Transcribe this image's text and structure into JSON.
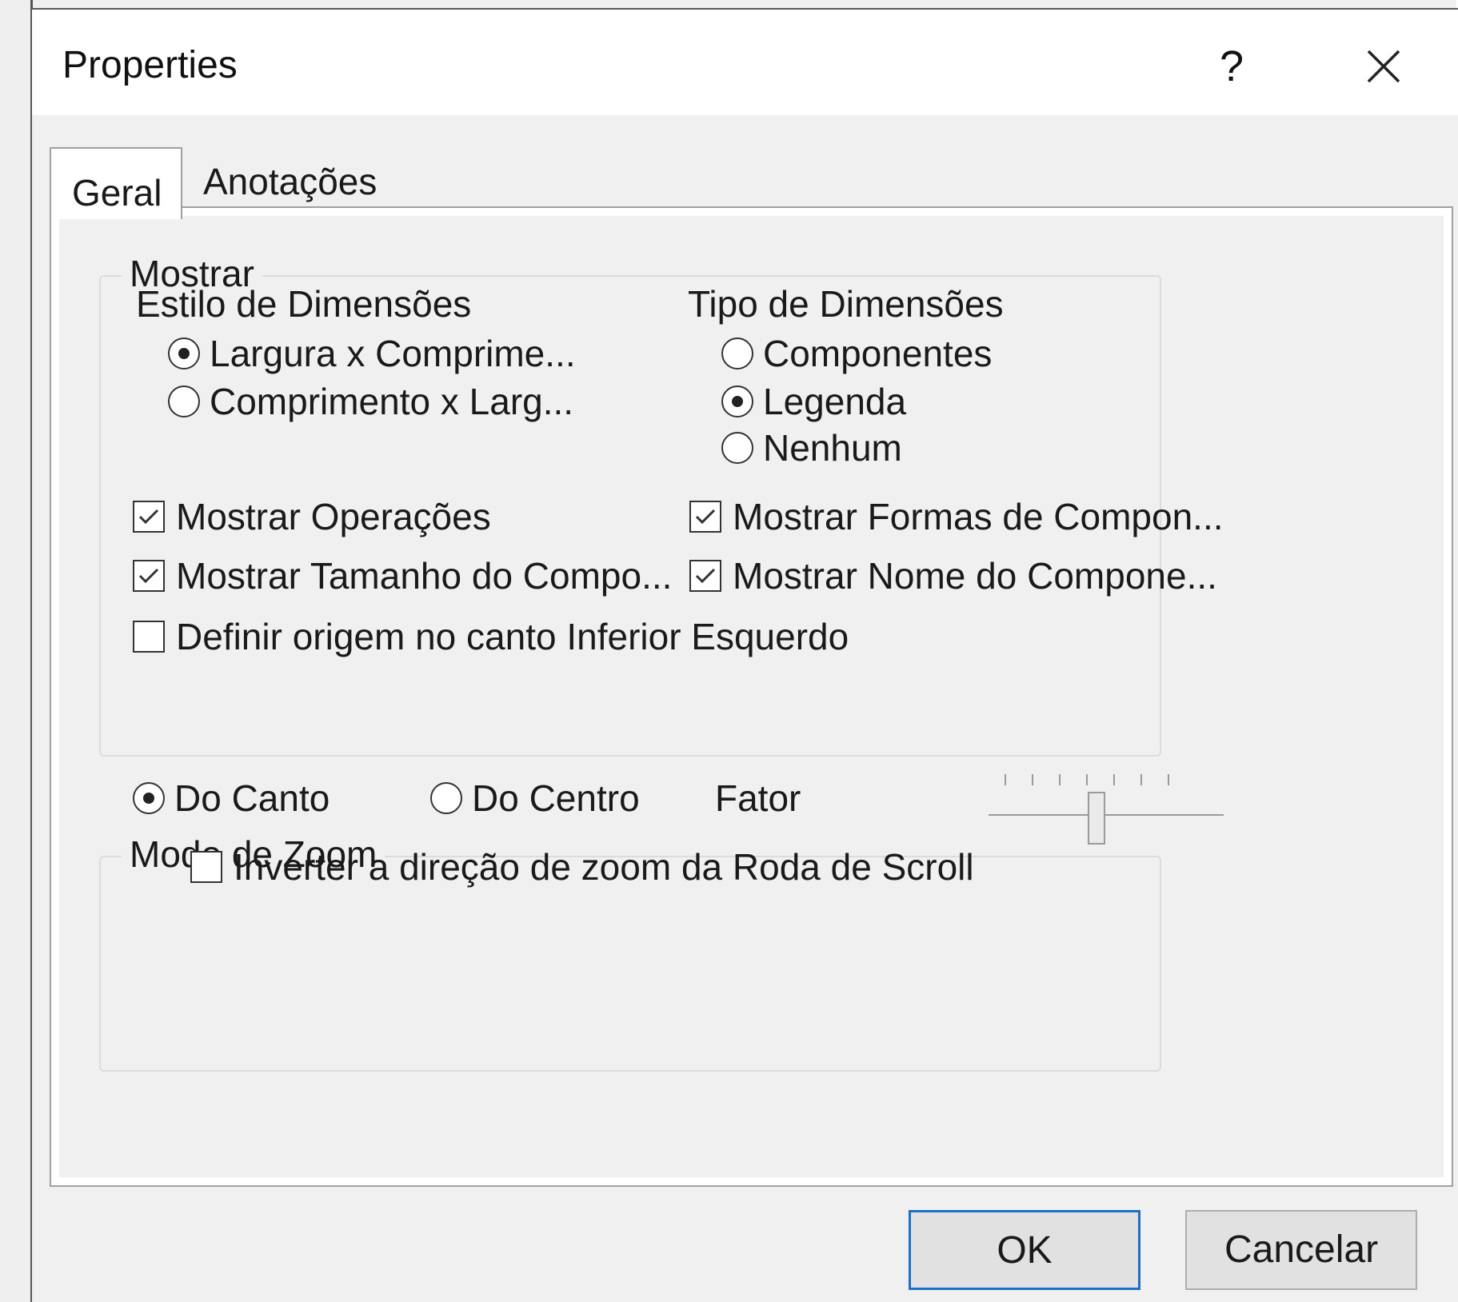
{
  "dialog": {
    "title": "Properties",
    "help_label": "?",
    "icons": {
      "close": "close-icon",
      "help": "help-icon"
    }
  },
  "tabs": [
    {
      "label": "Geral",
      "active": true
    },
    {
      "label": "Anotações",
      "active": false
    }
  ],
  "mostrar": {
    "title": "Mostrar",
    "estilo": {
      "label": "Estilo de Dimensões",
      "options": [
        {
          "label": "Largura x Comprime...",
          "selected": true
        },
        {
          "label": "Comprimento x Larg...",
          "selected": false
        }
      ]
    },
    "tipo": {
      "label": "Tipo de Dimensões",
      "options": [
        {
          "label": "Componentes",
          "selected": false
        },
        {
          "label": "Legenda",
          "selected": true
        },
        {
          "label": "Nenhum",
          "selected": false
        }
      ]
    },
    "checks": [
      {
        "label": "Mostrar Operações",
        "checked": true
      },
      {
        "label": "Mostrar Formas de Compon...",
        "checked": true
      },
      {
        "label": "Mostrar Tamanho do Compo...",
        "checked": true
      },
      {
        "label": "Mostrar Nome do Compone...",
        "checked": true
      },
      {
        "label": "Definir origem no canto Inferior Esquerdo",
        "checked": false
      }
    ]
  },
  "zoom": {
    "title": "Modo de Zoom",
    "options": [
      {
        "label": "Do Canto",
        "selected": true
      },
      {
        "label": "Do Centro",
        "selected": false
      }
    ],
    "factor_label": "Fator",
    "factor_level": 0.46,
    "invert": {
      "label": "Inverter a direção de zoom da Roda de Scroll",
      "checked": false
    }
  },
  "buttons": {
    "ok": "OK",
    "cancel": "Cancelar"
  },
  "colors": {
    "accent": "#1f6fc5",
    "window_bg": "#f0f0f0",
    "panel_bg": "#ffffff"
  }
}
